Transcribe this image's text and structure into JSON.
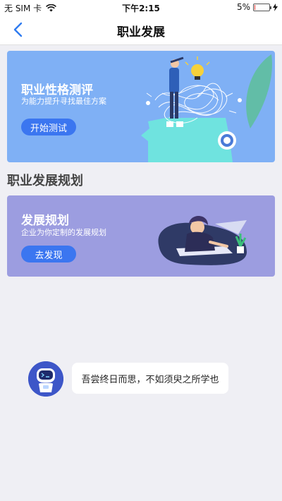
{
  "status_bar": {
    "carrier": "无 SIM 卡",
    "time": "下午2:15",
    "battery_percent": "5%",
    "battery_level": 0.05
  },
  "nav": {
    "title": "职业发展",
    "back_icon": "chevron-left-icon"
  },
  "cards": [
    {
      "title": "职业性格测评",
      "subtitle": "为能力提升寻找最佳方案",
      "button_label": "开始测试",
      "background": "#7fb0f5"
    },
    {
      "title": "发展规划",
      "subtitle": "企业为你定制的发展规划",
      "button_label": "去发现",
      "background": "#9c9de0"
    }
  ],
  "section": {
    "heading": "职业发展规划"
  },
  "bot": {
    "message": "吾尝终日而思，不如须臾之所学也",
    "avatar_icon": "robot-icon"
  },
  "colors": {
    "accent": "#3b76f0",
    "battery_low": "#e53935",
    "page_background": "#efeff4"
  }
}
